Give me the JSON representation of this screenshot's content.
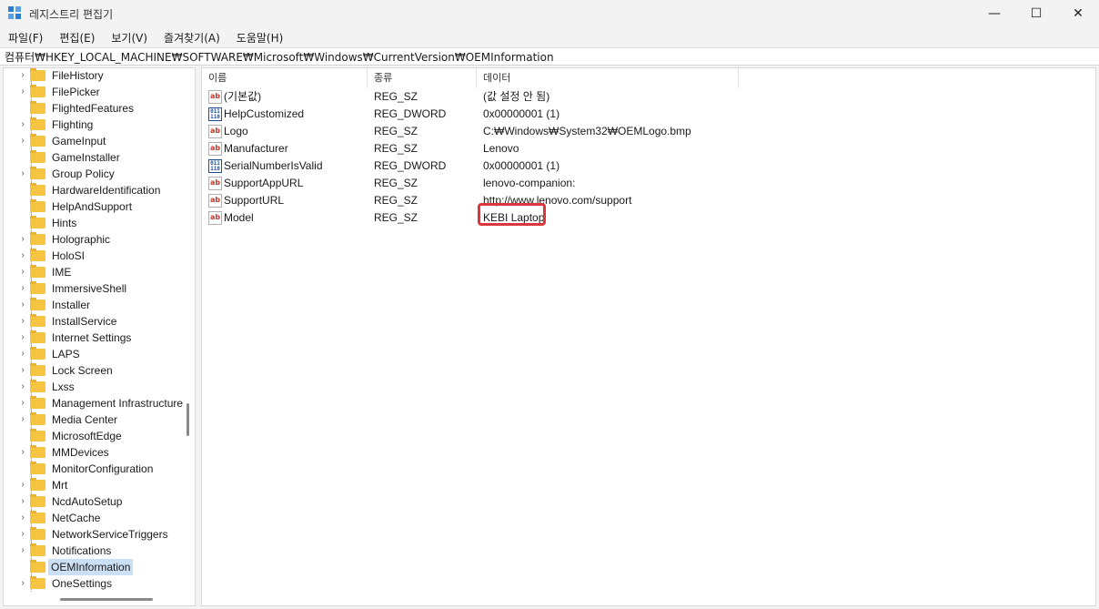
{
  "window": {
    "title": "레지스트리 편집기",
    "minimize_glyph": "—",
    "maximize_glyph": "☐",
    "close_glyph": "✕"
  },
  "menu": [
    "파일(F)",
    "편집(E)",
    "보기(V)",
    "즐겨찾기(A)",
    "도움말(H)"
  ],
  "address": "컴퓨터₩HKEY_LOCAL_MACHINE₩SOFTWARE₩Microsoft₩Windows₩CurrentVersion₩OEMInformation",
  "tree": {
    "expand_glyph": "›",
    "items": [
      {
        "label": "FileHistory",
        "expandable": true
      },
      {
        "label": "FilePicker",
        "expandable": true
      },
      {
        "label": "FlightedFeatures",
        "expandable": false
      },
      {
        "label": "Flighting",
        "expandable": true
      },
      {
        "label": "GameInput",
        "expandable": true
      },
      {
        "label": "GameInstaller",
        "expandable": false
      },
      {
        "label": "Group Policy",
        "expandable": true
      },
      {
        "label": "HardwareIdentification",
        "expandable": false
      },
      {
        "label": "HelpAndSupport",
        "expandable": false
      },
      {
        "label": "Hints",
        "expandable": false
      },
      {
        "label": "Holographic",
        "expandable": true
      },
      {
        "label": "HoloSI",
        "expandable": true
      },
      {
        "label": "IME",
        "expandable": true
      },
      {
        "label": "ImmersiveShell",
        "expandable": true
      },
      {
        "label": "Installer",
        "expandable": true
      },
      {
        "label": "InstallService",
        "expandable": true
      },
      {
        "label": "Internet Settings",
        "expandable": true
      },
      {
        "label": "LAPS",
        "expandable": true
      },
      {
        "label": "Lock Screen",
        "expandable": true
      },
      {
        "label": "Lxss",
        "expandable": true
      },
      {
        "label": "Management Infrastructure",
        "expandable": true
      },
      {
        "label": "Media Center",
        "expandable": true
      },
      {
        "label": "MicrosoftEdge",
        "expandable": false
      },
      {
        "label": "MMDevices",
        "expandable": true
      },
      {
        "label": "MonitorConfiguration",
        "expandable": false
      },
      {
        "label": "Mrt",
        "expandable": true
      },
      {
        "label": "NcdAutoSetup",
        "expandable": true
      },
      {
        "label": "NetCache",
        "expandable": true
      },
      {
        "label": "NetworkServiceTriggers",
        "expandable": true
      },
      {
        "label": "Notifications",
        "expandable": true
      },
      {
        "label": "OEMInformation",
        "expandable": false,
        "selected": true
      },
      {
        "label": "OneSettings",
        "expandable": true
      }
    ]
  },
  "list": {
    "columns": [
      "이름",
      "종류",
      "데이터"
    ],
    "rows": [
      {
        "icon": "string-value-icon",
        "icon_text": "ab",
        "name": "(기본값)",
        "type": "REG_SZ",
        "data": "(값 설정 안 됨)"
      },
      {
        "icon": "binary-value-icon",
        "icon_text": "011 110",
        "name": "HelpCustomized",
        "type": "REG_DWORD",
        "data": "0x00000001 (1)"
      },
      {
        "icon": "string-value-icon",
        "icon_text": "ab",
        "name": "Logo",
        "type": "REG_SZ",
        "data": "C:₩Windows₩System32₩OEMLogo.bmp"
      },
      {
        "icon": "string-value-icon",
        "icon_text": "ab",
        "name": "Manufacturer",
        "type": "REG_SZ",
        "data": "Lenovo"
      },
      {
        "icon": "binary-value-icon",
        "icon_text": "011 110",
        "name": "SerialNumberIsValid",
        "type": "REG_DWORD",
        "data": "0x00000001 (1)"
      },
      {
        "icon": "string-value-icon",
        "icon_text": "ab",
        "name": "SupportAppURL",
        "type": "REG_SZ",
        "data": "lenovo-companion:"
      },
      {
        "icon": "string-value-icon",
        "icon_text": "ab",
        "name": "SupportURL",
        "type": "REG_SZ",
        "data": "http://www.lenovo.com/support"
      },
      {
        "icon": "string-value-icon",
        "icon_text": "ab",
        "name": "Model",
        "type": "REG_SZ",
        "data": "KEBI Laptop",
        "highlighted": true
      }
    ]
  },
  "colors": {
    "highlight_border": "#d9363e",
    "selection": "#cce0f5",
    "folder": "#f5c542"
  }
}
